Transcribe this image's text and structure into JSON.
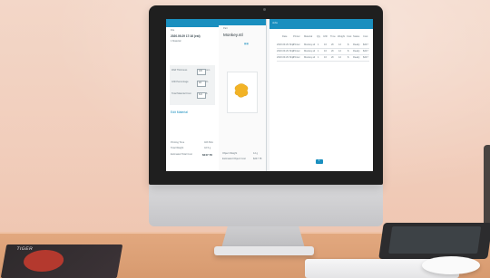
{
  "screen": {
    "left_panel": {
      "header_label": "File",
      "date_line": "2020.09.29 17:16 (est)",
      "sub_line": "1 Material",
      "settings": [
        {
          "label": "Wall Thickness",
          "value": "0.8",
          "unit": "mm"
        },
        {
          "label": "Infill Percentage",
          "value": "16",
          "unit": "%"
        },
        {
          "label": "Total Material Cost",
          "value": "6.9",
          "unit": "$"
        }
      ],
      "link": "Edit Material",
      "summary": [
        {
          "label": "Printing Time",
          "value": "02h 50m"
        },
        {
          "label": "Total Weight",
          "value": "42.5 g"
        },
        {
          "label": "Estimated Total Cost",
          "value": "$247.78"
        }
      ]
    },
    "middle_panel": {
      "header_label": "Part",
      "title": "Monkey.stl",
      "summary": [
        {
          "label": "Object Weight",
          "value": "12 g"
        },
        {
          "label": "Estimated Object Cost",
          "value": "$247.78"
        }
      ]
    },
    "right_panel": {
      "header_label": "Jobs",
      "columns": [
        "Date",
        "Printer",
        "Material",
        "Qty",
        "Infill",
        "Time",
        "Weight",
        "Cost",
        "Status",
        "Cost"
      ],
      "rows": [
        [
          "2020.09.29 Ship",
          "Printer",
          "Monkey.stl",
          "1",
          "16",
          "2h",
          "12",
          "$",
          "Ready",
          "$247"
        ],
        [
          "2020.09.29 Ship",
          "Printer",
          "Monkey.stl",
          "1",
          "16",
          "2h",
          "12",
          "$",
          "Ready",
          "$247"
        ],
        [
          "2020.09.29 Ship",
          "Printer",
          "Monkey.stl",
          "1",
          "16",
          "2h",
          "12",
          "$",
          "Ready",
          "$247"
        ]
      ],
      "pager": "1"
    }
  },
  "book": {
    "title": "TIGER"
  },
  "colors": {
    "accent": "#1a8fbf",
    "wall": "#f1cdbb",
    "desk": "#d79a6f",
    "part": "#f2b326"
  }
}
